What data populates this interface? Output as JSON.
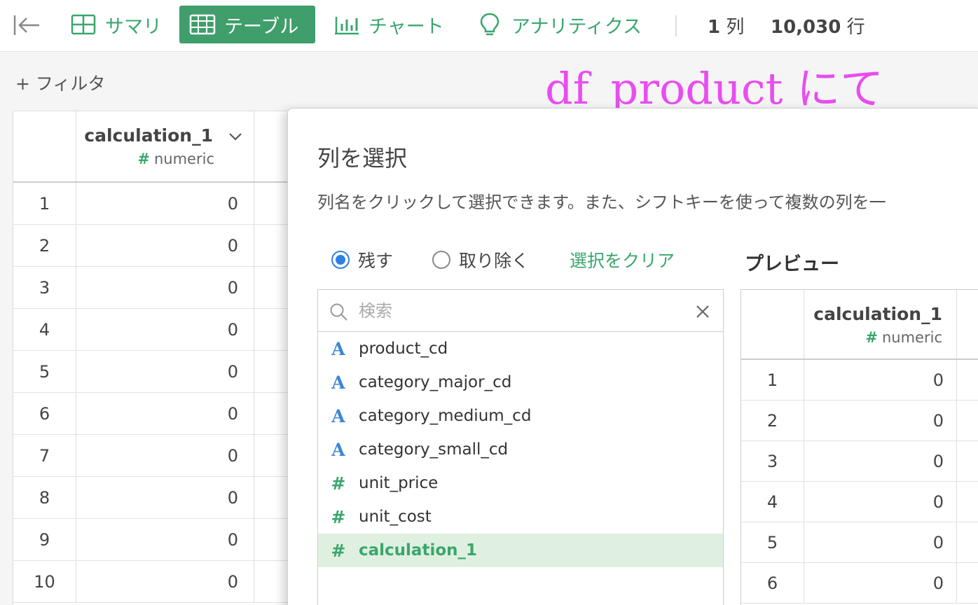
{
  "toolbar": {
    "tabs": [
      {
        "label": "サマリ",
        "icon": "summary-grid-icon"
      },
      {
        "label": "テーブル",
        "icon": "table-icon"
      },
      {
        "label": "チャート",
        "icon": "bar-chart-icon"
      },
      {
        "label": "アナリティクス",
        "icon": "lightbulb-icon"
      }
    ],
    "col_count": "1",
    "col_unit": "列",
    "row_count": "10,030",
    "row_unit": "行"
  },
  "filter": {
    "label": "+ フィルタ"
  },
  "annotation": "df_product にて",
  "main_table": {
    "column": {
      "name": "calculation_1",
      "type_symbol": "#",
      "type": "numeric"
    },
    "rows": [
      {
        "index": "1",
        "value": "0"
      },
      {
        "index": "2",
        "value": "0"
      },
      {
        "index": "3",
        "value": "0"
      },
      {
        "index": "4",
        "value": "0"
      },
      {
        "index": "5",
        "value": "0"
      },
      {
        "index": "6",
        "value": "0"
      },
      {
        "index": "7",
        "value": "0"
      },
      {
        "index": "8",
        "value": "0"
      },
      {
        "index": "9",
        "value": "0"
      },
      {
        "index": "10",
        "value": "0"
      }
    ]
  },
  "dialog": {
    "title": "列を選択",
    "description": "列名をクリックして選択できます。また、シフトキーを使って複数の列を一",
    "radio_keep": "残す",
    "radio_remove": "取り除く",
    "clear_selection": "選択をクリア",
    "preview_title": "プレビュー",
    "search_placeholder": "検索",
    "columns": [
      {
        "name": "product_cd",
        "type": "string",
        "symbol": "A",
        "selected": false
      },
      {
        "name": "category_major_cd",
        "type": "string",
        "symbol": "A",
        "selected": false
      },
      {
        "name": "category_medium_cd",
        "type": "string",
        "symbol": "A",
        "selected": false
      },
      {
        "name": "category_small_cd",
        "type": "string",
        "symbol": "A",
        "selected": false
      },
      {
        "name": "unit_price",
        "type": "numeric",
        "symbol": "#",
        "selected": false
      },
      {
        "name": "unit_cost",
        "type": "numeric",
        "symbol": "#",
        "selected": false
      },
      {
        "name": "calculation_1",
        "type": "numeric",
        "symbol": "#",
        "selected": true
      }
    ],
    "preview": {
      "column": {
        "name": "calculation_1",
        "type_symbol": "#",
        "type": "numeric"
      },
      "rows": [
        {
          "index": "1",
          "value": "0"
        },
        {
          "index": "2",
          "value": "0"
        },
        {
          "index": "3",
          "value": "0"
        },
        {
          "index": "4",
          "value": "0"
        },
        {
          "index": "5",
          "value": "0"
        },
        {
          "index": "6",
          "value": "0"
        }
      ]
    }
  },
  "colors": {
    "accent_green": "#3f9e6b",
    "radio_blue": "#2f7fe6",
    "annotation_pink": "#e84df0"
  }
}
